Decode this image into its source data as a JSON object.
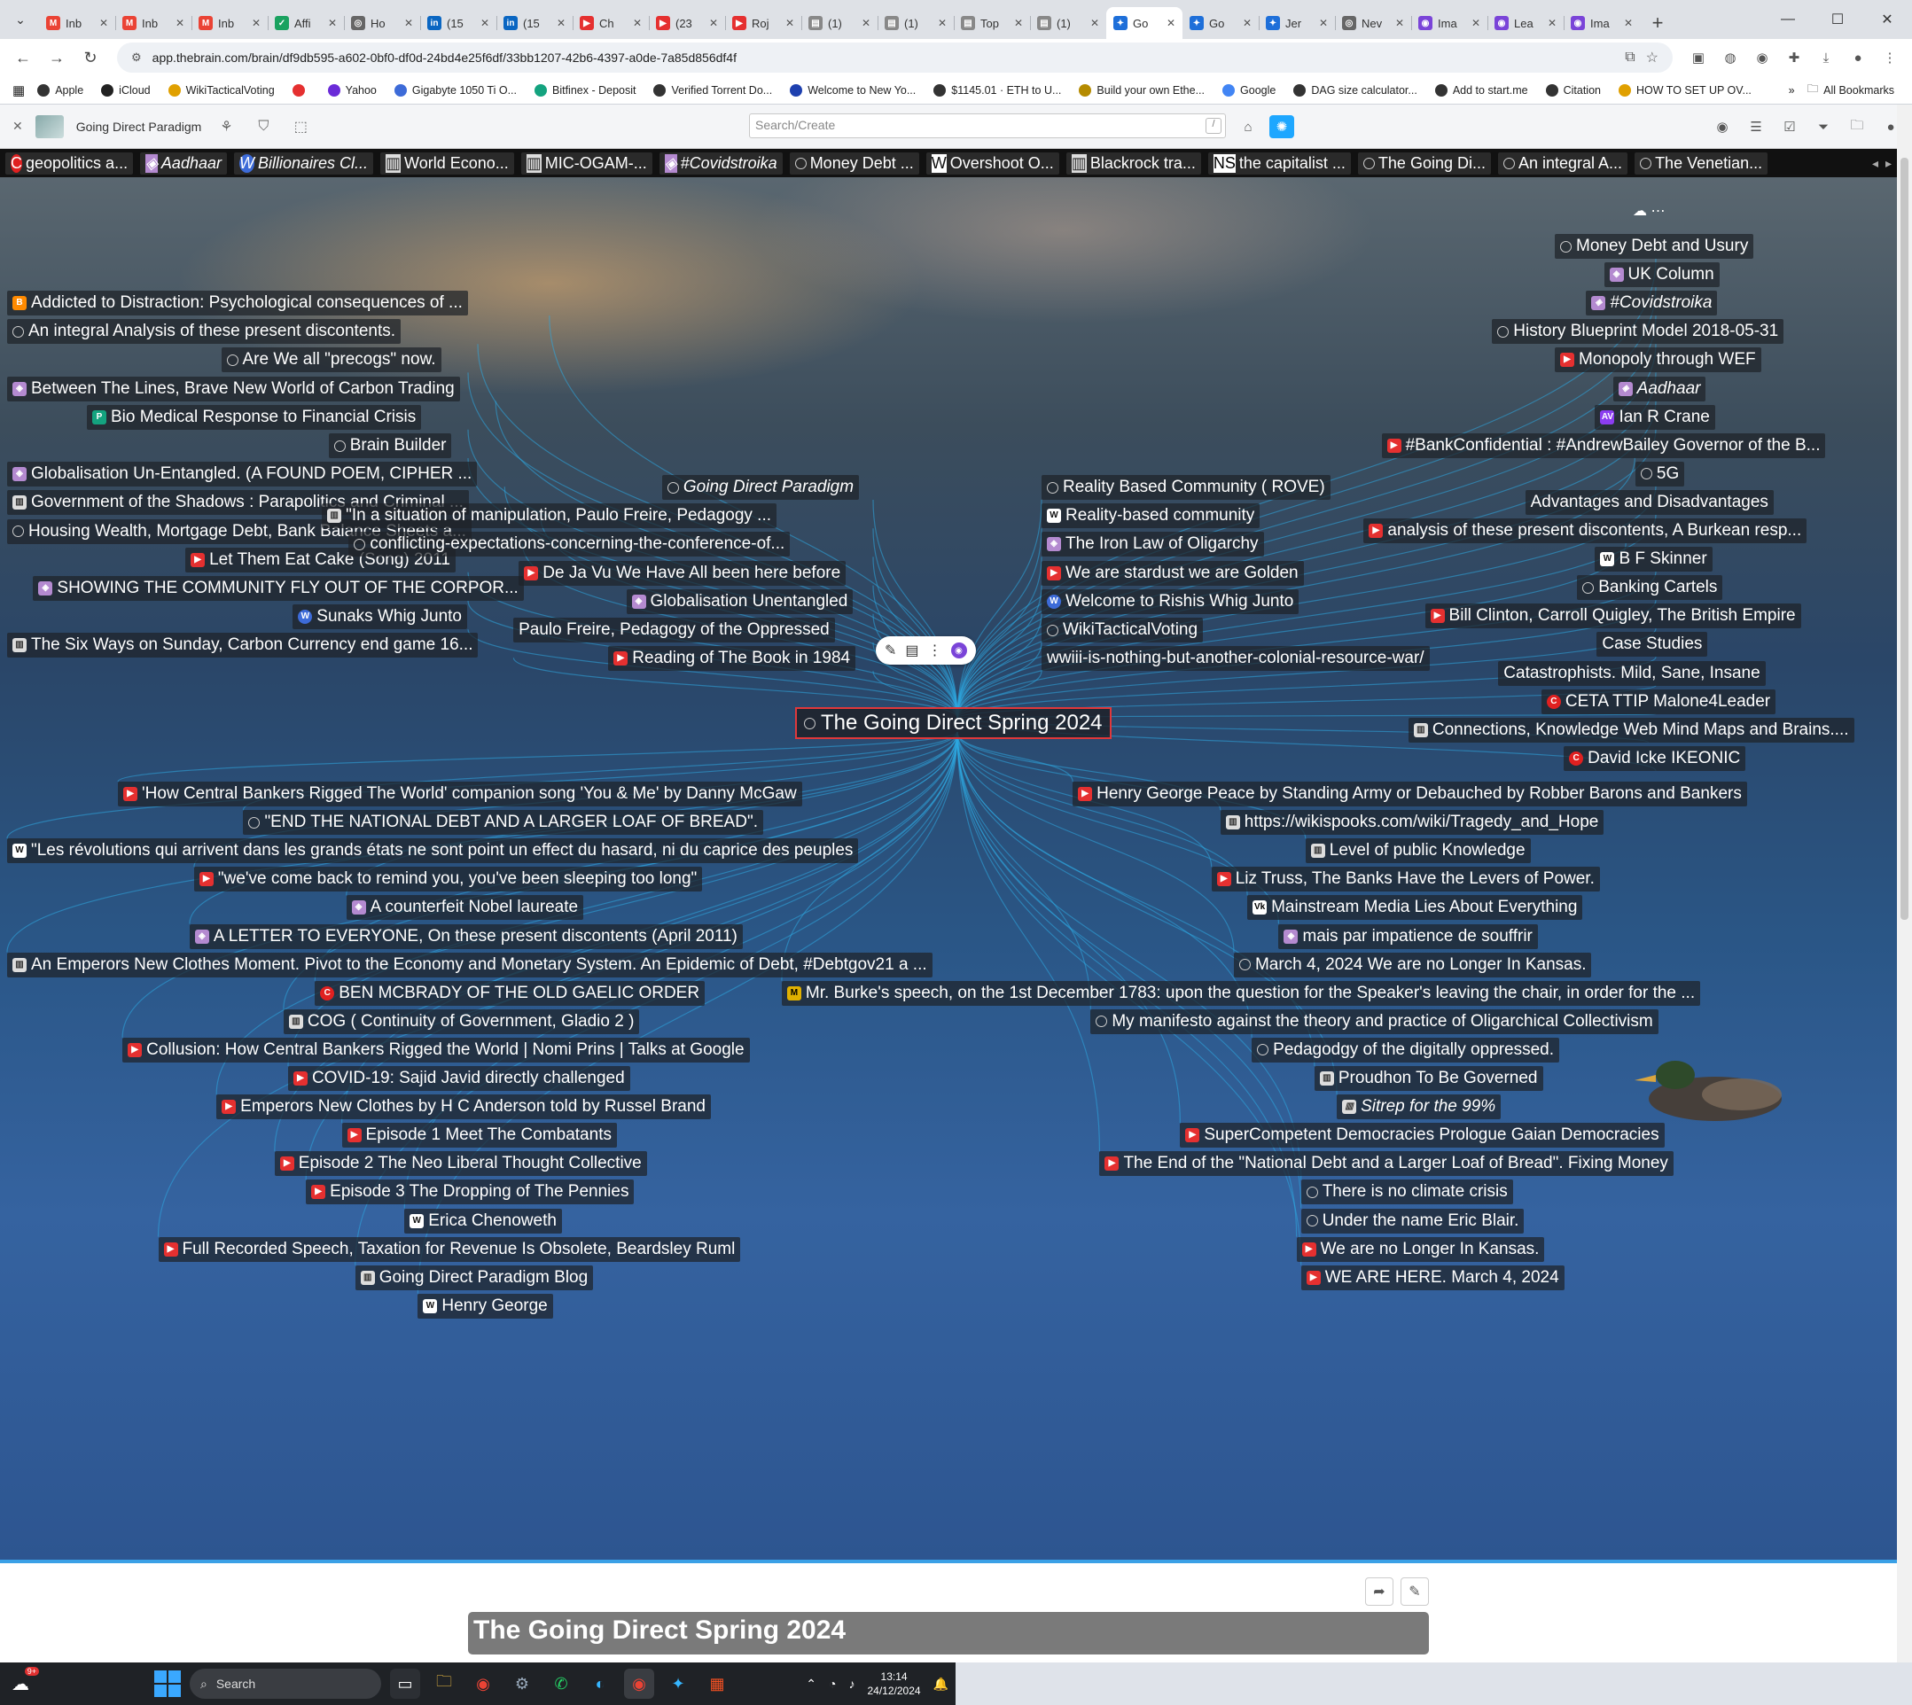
{
  "browser": {
    "tabs": [
      {
        "label": "Inb",
        "fav": "M",
        "color": "#ea4335"
      },
      {
        "label": "Inb",
        "fav": "M",
        "color": "#ea4335"
      },
      {
        "label": "Inb",
        "fav": "M",
        "color": "#ea4335"
      },
      {
        "label": "Affi",
        "fav": "✓",
        "color": "#1aa260"
      },
      {
        "label": "Ho",
        "fav": "◎",
        "color": "#666"
      },
      {
        "label": "(15",
        "fav": "in",
        "color": "#0a66c2"
      },
      {
        "label": "(15",
        "fav": "in",
        "color": "#0a66c2"
      },
      {
        "label": "Ch",
        "fav": "▶",
        "color": "#e53030"
      },
      {
        "label": "(23",
        "fav": "▶",
        "color": "#e53030"
      },
      {
        "label": "Roj",
        "fav": "▶",
        "color": "#e53030"
      },
      {
        "label": "(1)",
        "fav": "▤",
        "color": "#888"
      },
      {
        "label": "(1)",
        "fav": "▤",
        "color": "#888"
      },
      {
        "label": "Top",
        "fav": "▤",
        "color": "#888"
      },
      {
        "label": "(1)",
        "fav": "▤",
        "color": "#888"
      },
      {
        "label": "Go",
        "fav": "✦",
        "color": "#1e6fd9",
        "active": true
      },
      {
        "label": "Go",
        "fav": "✦",
        "color": "#1e6fd9"
      },
      {
        "label": "Jer",
        "fav": "✦",
        "color": "#1e6fd9"
      },
      {
        "label": "Nev",
        "fav": "◎",
        "color": "#666"
      },
      {
        "label": "Ima",
        "fav": "◉",
        "color": "#7a44d8"
      },
      {
        "label": "Lea",
        "fav": "◉",
        "color": "#7a44d8"
      },
      {
        "label": "Ima",
        "fav": "◉",
        "color": "#7a44d8"
      }
    ],
    "url": "app.thebrain.com/brain/df9db595-a602-0bf0-df0d-24bd4e25f6df/33bb1207-42b6-4397-a0de-7a85d856df4f",
    "bookmarks": [
      "Apple",
      "iCloud",
      "WikiTacticalVoting",
      "",
      "Yahoo",
      "Gigabyte 1050 Ti O...",
      "Bitfinex - Deposit",
      "Verified Torrent Do...",
      "Welcome to New Yo...",
      "$1145.01 · ETH to U...",
      "Build your own Ethe...",
      "Google",
      "DAG size calculator...",
      "Add to start.me",
      "Citation",
      "HOW TO SET UP OV..."
    ],
    "all_bookmarks": "All Bookmarks",
    "more": "»"
  },
  "app": {
    "brain_name": "Going Direct Paradigm",
    "search_placeholder": "Search/Create",
    "search_shortcut": "/"
  },
  "pins": [
    {
      "label": "geopolitics a...",
      "icon": "red"
    },
    {
      "label": "Aadhaar",
      "icon": "img",
      "italic": true
    },
    {
      "label": "Billionaires Cl...",
      "icon": "web",
      "italic": true
    },
    {
      "label": "World Econo...",
      "icon": "doc"
    },
    {
      "label": "MIC-OGAM-...",
      "icon": "doc"
    },
    {
      "label": "#Covidstroika",
      "icon": "img",
      "italic": true
    },
    {
      "label": "Money Debt ...",
      "icon": "thought"
    },
    {
      "label": "Overshoot O...",
      "icon": "wiki"
    },
    {
      "label": "Blackrock tra...",
      "icon": "doc"
    },
    {
      "label": "the capitalist ...",
      "icon": "mk"
    },
    {
      "label": "The Going Di...",
      "icon": "thought"
    },
    {
      "label": "An integral A...",
      "icon": "thought"
    },
    {
      "label": "The Venetian...",
      "icon": "thought"
    }
  ],
  "central_thought": "The Going Direct Spring 2024",
  "nodes": {
    "left_parents": [
      {
        "label": "Addicted to Distraction: Psychological consequences of ...",
        "icon": "blog"
      },
      {
        "label": "An integral Analysis of these present discontents.",
        "icon": "thought"
      },
      {
        "label": "Are We all \"precogs\" now.",
        "icon": "thought"
      },
      {
        "label": "Between The Lines, Brave New World of Carbon Trading",
        "icon": "img"
      },
      {
        "label": "Bio Medical Response to Financial Crisis",
        "icon": "green",
        "glyph": "P"
      },
      {
        "label": "Brain Builder",
        "icon": "thought"
      },
      {
        "label": "Globalisation Un-Entangled. (A FOUND POEM, CIPHER ...",
        "icon": "img"
      },
      {
        "label": "Government of the Shadows : Parapolitics and Criminal ...",
        "icon": "doc"
      },
      {
        "label": "Housing Wealth, Mortgage Debt, Bank Balance Sheets a...",
        "icon": "thought"
      },
      {
        "label": "Let Them Eat Cake (Song) 2011",
        "icon": "yt"
      },
      {
        "label": "SHOWING THE COMMUNITY FLY OUT OF THE CORPOR...",
        "icon": "img"
      },
      {
        "label": "Sunaks Whig Junto",
        "icon": "web"
      },
      {
        "label": "The Six Ways on Sunday, Carbon Currency end game 16...",
        "icon": "doc"
      }
    ],
    "mid_left_parents": [
      {
        "label": "Going Direct Paradigm",
        "icon": "thought",
        "italic": true
      },
      {
        "label": "\"In a situation of manipulation, Paulo Freire, Pedagogy ...",
        "icon": "doc"
      },
      {
        "label": "conflicting-expectations-concerning-the-conference-of...",
        "icon": "thought"
      },
      {
        "label": "De Ja Vu We Have All been here before",
        "icon": "yt"
      },
      {
        "label": "Globalisation Unentangled",
        "icon": "img"
      },
      {
        "label": "Paulo Freire, Pedagogy of the Oppressed",
        "icon": ""
      },
      {
        "label": "Reading of The Book in 1984",
        "icon": "yt"
      }
    ],
    "mid_right_parents": [
      {
        "label": "Reality Based Community ( ROVE)",
        "icon": "thought"
      },
      {
        "label": "Reality-based community",
        "icon": "wiki"
      },
      {
        "label": "The Iron Law of Oligarchy",
        "icon": "img"
      },
      {
        "label": "We are stardust we are Golden",
        "icon": "yt"
      },
      {
        "label": "Welcome to Rishis Whig Junto",
        "icon": "web"
      },
      {
        "label": "WikiTacticalVoting",
        "icon": "thought"
      },
      {
        "label": "wwiii-is-nothing-but-another-colonial-resource-war/",
        "icon": ""
      }
    ],
    "right_parents": [
      {
        "label": "Money Debt and Usury",
        "icon": "thought"
      },
      {
        "label": "UK Column",
        "icon": "img"
      },
      {
        "label": "#Covidstroika",
        "icon": "img",
        "italic": true
      },
      {
        "label": "History Blueprint Model 2018-05-31",
        "icon": "thought"
      },
      {
        "label": "Monopoly through WEF",
        "icon": "yt"
      },
      {
        "label": "Aadhaar",
        "icon": "img",
        "italic": true
      },
      {
        "label": "Ian R Crane",
        "icon": "purple",
        "glyph": "AV"
      },
      {
        "label": "#BankConfidential : #AndrewBailey Governor of the B...",
        "icon": "yt"
      },
      {
        "label": "5G",
        "icon": "thought"
      },
      {
        "label": "Advantages and Disadvantages",
        "icon": ""
      },
      {
        "label": "analysis of these present discontents, A Burkean resp...",
        "icon": "yt"
      },
      {
        "label": "B F Skinner",
        "icon": "wiki"
      },
      {
        "label": "Banking Cartels",
        "icon": "thought"
      },
      {
        "label": "Bill Clinton, Carroll Quigley, The British Empire",
        "icon": "yt"
      },
      {
        "label": "Case Studies",
        "icon": ""
      },
      {
        "label": "Catastrophists. Mild, Sane, Insane",
        "icon": ""
      },
      {
        "label": "CETA TTIP Malone4Leader",
        "icon": "red"
      },
      {
        "label": "Connections, Knowledge Web Mind Maps and Brains....",
        "icon": "doc"
      },
      {
        "label": "David Icke IKEONIC",
        "icon": "red"
      }
    ],
    "left_children": [
      {
        "label": "'How Central Bankers Rigged The World' companion song 'You & Me' by Danny McGaw",
        "icon": "yt"
      },
      {
        "label": "\"END THE NATIONAL DEBT AND A LARGER LOAF OF BREAD\".",
        "icon": "thought"
      },
      {
        "label": "\"Les révolutions qui arrivent dans les grands états ne sont point un effect du hasard, ni du caprice des peuples",
        "icon": "wiki"
      },
      {
        "label": "\"we've come back to remind you, you've been sleeping too long\"",
        "icon": "yt"
      },
      {
        "label": "A counterfeit Nobel laureate",
        "icon": "img"
      },
      {
        "label": "A LETTER TO EVERYONE, On these present discontents (April 2011)",
        "icon": "img"
      },
      {
        "label": "An Emperors New Clothes Moment. Pivot to the Economy and Monetary System. An Epidemic of Debt, #Debtgov21 a ...",
        "icon": "doc"
      },
      {
        "label": "BEN MCBRADY OF THE OLD GAELIC ORDER",
        "icon": "red"
      },
      {
        "label": "COG ( Continuity of Government, Gladio 2 )",
        "icon": "doc"
      },
      {
        "label": "Collusion: How Central Bankers Rigged the World | Nomi Prins | Talks at Google",
        "icon": "yt"
      },
      {
        "label": "COVID-19: Sajid Javid directly challenged",
        "icon": "yt"
      },
      {
        "label": "Emperors New Clothes by H C Anderson told by Russel Brand",
        "icon": "yt"
      },
      {
        "label": "Episode 1 Meet The Combatants",
        "icon": "yt"
      },
      {
        "label": "Episode 2 The Neo Liberal Thought Collective",
        "icon": "yt"
      },
      {
        "label": "Episode 3 The Dropping of The Pennies",
        "icon": "yt"
      },
      {
        "label": "Erica Chenoweth",
        "icon": "wiki"
      },
      {
        "label": "Full Recorded Speech, Taxation for Revenue Is Obsolete, Beardsley Ruml",
        "icon": "yt"
      },
      {
        "label": "Going Direct Paradigm Blog",
        "icon": "doc"
      },
      {
        "label": "Henry George",
        "icon": "wiki"
      }
    ],
    "right_children": [
      {
        "label": "Henry George Peace by Standing Army or Debauched by Robber Barons and Bankers",
        "icon": "yt"
      },
      {
        "label": "https://wikispooks.com/wiki/Tragedy_and_Hope",
        "icon": "doc"
      },
      {
        "label": "Level of public Knowledge",
        "icon": "doc"
      },
      {
        "label": "Liz Truss, The Banks Have the Levers of Power.",
        "icon": "yt"
      },
      {
        "label": "Mainstream Media Lies About Everything",
        "icon": "mk",
        "glyph": "Vk"
      },
      {
        "label": "mais par impatience de souffrir",
        "icon": "img"
      },
      {
        "label": "March 4, 2024 We are no Longer In Kansas.",
        "icon": "thought"
      },
      {
        "label": "Mr. Burke's speech, on the 1st December 1783: upon the question for the Speaker's leaving the chair, in order for the ...",
        "icon": "gold",
        "glyph": "M"
      },
      {
        "label": "My manifesto against the theory and practice of Oligarchical Collectivism",
        "icon": "thought"
      },
      {
        "label": "Pedagodgy of the digitally oppressed.",
        "icon": "thought"
      },
      {
        "label": "Proudhon To Be Governed",
        "icon": "doc"
      },
      {
        "label": "Sitrep for the 99%",
        "icon": "doc",
        "italic": true
      },
      {
        "label": "SuperCompetent Democracies Prologue Gaian Democracies",
        "icon": "yt"
      },
      {
        "label": "The End of the \"National Debt and a Larger Loaf of Bread\". Fixing Money",
        "icon": "yt"
      },
      {
        "label": "There is no climate crisis",
        "icon": "thought"
      },
      {
        "label": "Under the name Eric Blair.",
        "icon": "thought"
      },
      {
        "label": "We are no Longer In Kansas.",
        "icon": "yt"
      },
      {
        "label": "WE ARE HERE. March 4, 2024",
        "icon": "yt"
      }
    ]
  },
  "notes": {
    "title": "The Going Direct Spring 2024"
  },
  "taskbar": {
    "weather_badge": "9+",
    "search_label": "Search",
    "time": "13:14",
    "date": "24/12/2024"
  },
  "colors": {
    "accent": "#1ea7ff",
    "central_border": "#e0383b",
    "link_line": "#2ea8e0"
  }
}
